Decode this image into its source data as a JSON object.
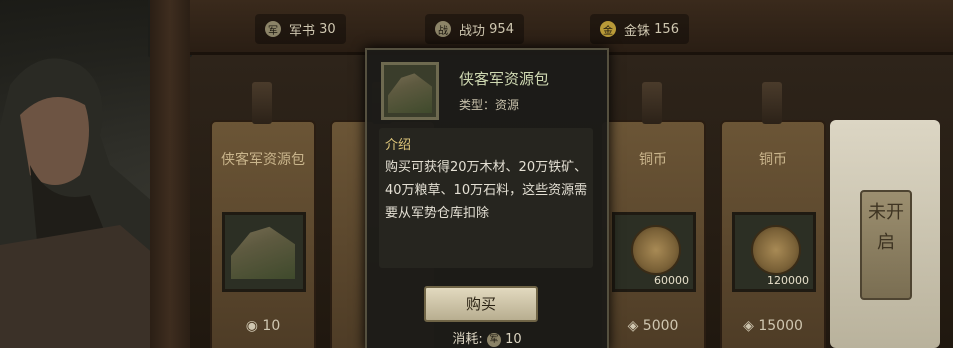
{
  "resources": [
    {
      "icon": "book-token-icon",
      "label": "军书",
      "value": "30"
    },
    {
      "icon": "merit-icon",
      "label": "战功",
      "value": "954"
    },
    {
      "icon": "gold-coin-icon",
      "label": "金铢",
      "value": "156"
    }
  ],
  "shop": {
    "items": [
      {
        "name": "侠客军资源包",
        "price": "10",
        "amount": ""
      },
      {
        "name": "铜币",
        "price": "5000",
        "amount": "60000"
      },
      {
        "name": "铜币",
        "price": "15000",
        "amount": "120000"
      }
    ],
    "locked_label": "未开启"
  },
  "popup": {
    "title": "侠客军资源包",
    "type": "类型：资源",
    "intro_header": "介绍",
    "description": "购买可获得20万木材、20万铁矿、40万粮草、10万石料，这些资源需要从军势仓库扣除",
    "buy_label": "购买",
    "cost_label": "消耗:",
    "cost_value": "10"
  }
}
